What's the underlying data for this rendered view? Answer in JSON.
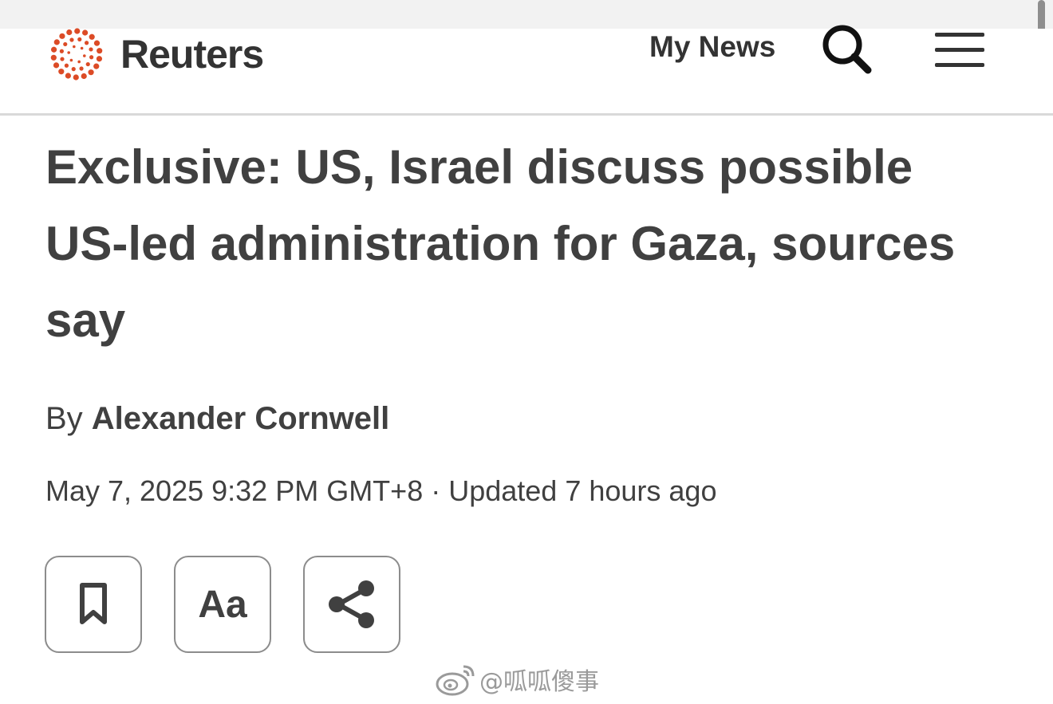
{
  "header": {
    "logo_text": "Reuters",
    "brand_color": "#dc4b26",
    "my_news_label": "My News"
  },
  "article": {
    "headline": "Exclusive: US, Israel discuss possible US-led administration for Gaza, sources say",
    "byline_prefix": "By ",
    "author": "Alexander Cornwell",
    "dateline": "May 7, 2025 9:32 PM GMT+8 · Updated 7 hours ago"
  },
  "actions": {
    "text_size_label": "Aa"
  },
  "watermark": {
    "text": "@呱呱傻事"
  }
}
